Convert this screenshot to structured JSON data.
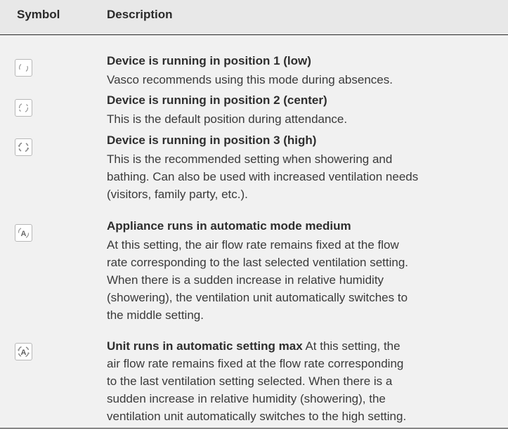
{
  "header": {
    "symbol": "Symbol",
    "description": "Description"
  },
  "rows": [
    {
      "icon": "fan-speed-1-icon",
      "title": "Device is running in position 1 (low)",
      "lines": [
        "Vasco recommends using this mode during absences."
      ]
    },
    {
      "icon": "fan-speed-2-icon",
      "title": "Device is running in position 2 (center)",
      "lines": [
        "This is the default position during attendance."
      ]
    },
    {
      "icon": "fan-speed-3-icon",
      "title": "Device is running in position 3 (high)",
      "lines": [
        "This is the recommended setting when showering and",
        "bathing. Can also be used with increased ventilation needs",
        "(visitors, family party, etc.)."
      ]
    },
    {
      "icon": "auto-medium-icon",
      "title": "Appliance runs in automatic mode medium",
      "lines": [
        "At this setting, the air flow rate remains fixed at the flow",
        "rate corresponding to the last selected ventilation setting.",
        "When there is a sudden increase in relative humidity",
        "(showering), the ventilation unit automatically switches to",
        "the middle setting."
      ]
    },
    {
      "icon": "auto-max-icon",
      "title": "Unit runs in automatic setting max",
      "first_line_rest": " At this setting, the",
      "lines": [
        "air flow rate remains fixed at the flow rate corresponding",
        "to the last ventilation setting selected. When there is a",
        "sudden increase in relative humidity (showering), the",
        "ventilation unit automatically switches to the high setting."
      ]
    }
  ]
}
